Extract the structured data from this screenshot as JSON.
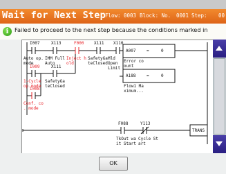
{
  "title": "Wait for Next Step",
  "fields": {
    "flow_label": "Flow:",
    "flow_value": "0003",
    "block_label": "Block: No.",
    "block_value": "0001",
    "step_label": "Step:",
    "step_value": "00"
  },
  "message": {
    "icon": "info-icon",
    "icon_glyph": "i",
    "text": "Failed to proceed to the next step because the conditions marked in"
  },
  "ladder": {
    "contacts_top": [
      "I007",
      "X113",
      "F000",
      "X111",
      "X110"
    ],
    "labels_top": [
      {
        "text": "Auto op. mode",
        "red": false
      },
      {
        "text": "IMM Full Auto",
        "red": false
      },
      {
        "text": "Inject h old",
        "red": true
      },
      {
        "text": "SafetyGa teClosed",
        "red": false
      },
      {
        "text": "Mld Open Limit",
        "red": false
      }
    ],
    "contacts_mid": [
      "I009",
      "X111"
    ],
    "labels_mid": [
      {
        "text": "1-Cycle op.mode",
        "red": true
      },
      {
        "text": "SafetyGa teClosed",
        "red": false
      }
    ],
    "contacts_low": [
      "I008"
    ],
    "labels_low": [
      {
        "text": "Conf. co . mode",
        "red": true
      }
    ],
    "box1": {
      "addr": "A007",
      "op": "=",
      "val": "0",
      "caption": "Error co ount"
    },
    "box2": {
      "addr": "A188",
      "op": "=",
      "val": "0",
      "caption": "Flow1 Ma ximum..."
    },
    "bottom_contacts": [
      "F088",
      "Y113"
    ],
    "bottom_labels": [
      "TkOut wa it Start",
      "Cycle St art"
    ],
    "trans": "TRANS"
  },
  "ok_label": "OK",
  "colors": {
    "title": "#e8731f",
    "scroll": "#3a2f98",
    "red": "#e8242a"
  }
}
